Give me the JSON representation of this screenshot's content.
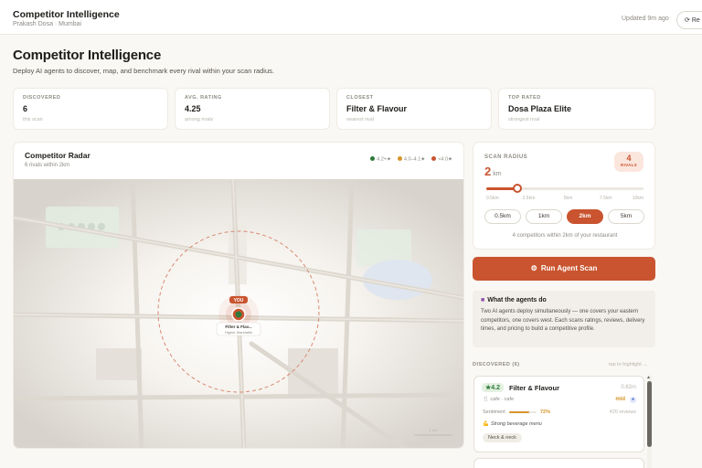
{
  "app": {
    "title": "Competitor Intelligence",
    "subtitle": "Prakash Dosa · Mumbai"
  },
  "topbar": {
    "updated": "Updated 9m ago",
    "refresh_label": "Re",
    "refresh_icon": "refresh-icon"
  },
  "header": {
    "title": "Competitor Intelligence",
    "description": "Deploy AI agents to discover, map, and benchmark every rival within your scan radius."
  },
  "stats": [
    {
      "label": "DISCOVERED",
      "value": "6",
      "sub": "this scan"
    },
    {
      "label": "AVG. RATING",
      "value": "4.25",
      "sub": "among rivals"
    },
    {
      "label": "CLOSEST",
      "value": "Filter & Flavour",
      "sub": "nearest rival"
    },
    {
      "label": "TOP RATED",
      "value": "Dosa Plaza Elite",
      "sub": "strongest rival"
    }
  ],
  "radar": {
    "title": "Competitor Radar",
    "subtitle": "6 rivals within 2km",
    "legend": [
      {
        "label": "4.2+★",
        "color": "#2f7a3b"
      },
      {
        "label": "4.0–4.1★",
        "color": "#d6942a"
      },
      {
        "label": "<4.0★",
        "color": "#c9542f"
      }
    ],
    "you_label": "YOU",
    "pin_label_1": "Filter & Flav...",
    "pin_label_2": "Higher Mandalke",
    "scale_label": "1 km"
  },
  "scan": {
    "label": "SCAN RADIUS",
    "value": "2",
    "unit": "km",
    "rivals_count": "4",
    "rivals_label": "RIVALS",
    "slider_fraction": 0.2,
    "ticks": [
      "0.5km",
      "2.5km",
      "5km",
      "7.5km",
      "10km"
    ],
    "chips": [
      "0.5km",
      "1km",
      "2km",
      "5km"
    ],
    "active_chip": "2km",
    "within_text": "4 competitors within 2km of your restaurant"
  },
  "run_button": {
    "label": "Run Agent Scan",
    "icon": "robot-icon"
  },
  "info": {
    "title": "What the agents do",
    "text": "Two AI agents deploy simultaneously — one covers your eastern competitors, one covers west. Each scans ratings, reviews, delivery times, and pricing to build a competitive profile."
  },
  "discovered": {
    "label": "DISCOVERED (6)",
    "hint": "tap to highlight →"
  },
  "competitors": [
    {
      "rating": "★4.2",
      "name": "Filter & Flavour",
      "distance": "0.62m",
      "category": "cafe · cafe",
      "price": "mid",
      "sentiment_label": "Sentiment",
      "sentiment": "72%",
      "sentiment_fraction": 0.72,
      "reviews": "420 reviews",
      "strength": "Strong beverage menu",
      "tag": "Neck & neck"
    }
  ],
  "colors": {
    "accent": "#c9542f",
    "good": "#2f7a3b",
    "mid": "#d6942a"
  }
}
